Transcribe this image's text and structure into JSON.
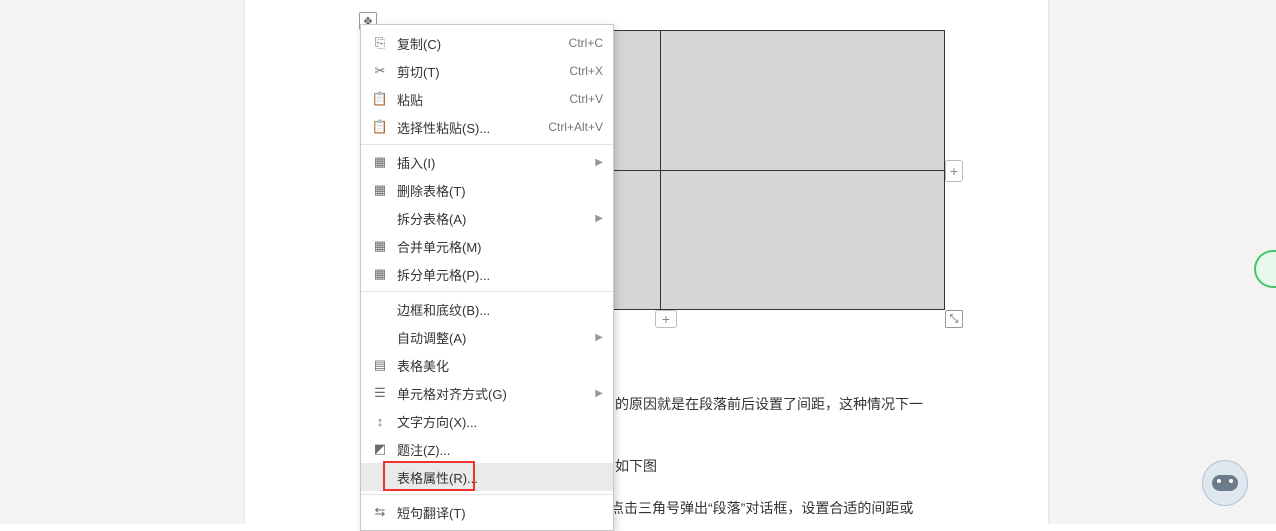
{
  "table": {
    "rows": 2,
    "cols": 2
  },
  "table_handles": {
    "move_glyph": "✥",
    "resize_glyph": "⤡",
    "add_right_glyph": "+",
    "add_bottom_glyph": "+"
  },
  "context_menu": {
    "items": [
      {
        "icon": "⎘",
        "label": "复制(C)",
        "shortcut": "Ctrl+C",
        "name": "menu-copy",
        "icon_name": "copy-icon"
      },
      {
        "icon": "✂",
        "label": "剪切(T)",
        "shortcut": "Ctrl+X",
        "name": "menu-cut",
        "icon_name": "cut-icon"
      },
      {
        "icon": "📋",
        "label": "粘贴",
        "shortcut": "Ctrl+V",
        "name": "menu-paste",
        "icon_name": "paste-icon"
      },
      {
        "icon": "📋",
        "label": "选择性粘贴(S)...",
        "shortcut": "Ctrl+Alt+V",
        "name": "menu-paste-special",
        "icon_name": "paste-special-icon"
      },
      {
        "sep": true
      },
      {
        "icon": "▦",
        "label": "插入(I)",
        "submenu": true,
        "name": "menu-insert",
        "icon_name": "insert-table-icon"
      },
      {
        "icon": "▦",
        "label": "删除表格(T)",
        "name": "menu-delete-table",
        "icon_name": "delete-table-icon"
      },
      {
        "icon": "",
        "label": "拆分表格(A)",
        "submenu": true,
        "name": "menu-split-table",
        "icon_name": "split-table-icon"
      },
      {
        "icon": "▦",
        "label": "合并单元格(M)",
        "name": "menu-merge-cells",
        "icon_name": "merge-cells-icon"
      },
      {
        "icon": "▦",
        "label": "拆分单元格(P)...",
        "name": "menu-split-cells",
        "icon_name": "split-cells-icon"
      },
      {
        "sep": true
      },
      {
        "icon": "",
        "label": "边框和底纹(B)...",
        "name": "menu-borders-shading",
        "icon_name": "borders-icon"
      },
      {
        "icon": "",
        "label": "自动调整(A)",
        "submenu": true,
        "name": "menu-autofit",
        "icon_name": "autofit-icon"
      },
      {
        "icon": "▤",
        "label": "表格美化",
        "name": "menu-table-beautify",
        "icon_name": "beautify-icon"
      },
      {
        "icon": "☰",
        "label": "单元格对齐方式(G)",
        "submenu": true,
        "name": "menu-cell-align",
        "icon_name": "align-icon"
      },
      {
        "icon": "↕",
        "label": "文字方向(X)...",
        "name": "menu-text-direction",
        "icon_name": "text-direction-icon"
      },
      {
        "icon": "◩",
        "label": "题注(Z)...",
        "name": "menu-caption",
        "icon_name": "caption-icon"
      },
      {
        "icon": "",
        "label": "表格属性(R)...",
        "name": "menu-table-properties",
        "highlight": true,
        "icon_name": "table-properties-icon"
      },
      {
        "sep": true
      },
      {
        "icon": "⇆",
        "label": "短句翻译(T)",
        "name": "menu-translate",
        "icon_name": "translate-icon"
      }
    ]
  },
  "body_text": {
    "line1": "的原因就是在段落前后设置了间距，这种情况下一",
    "line2": "如下图",
    "line3": "点击三角号弹出“段落”对话框，设置合适的间距或"
  }
}
